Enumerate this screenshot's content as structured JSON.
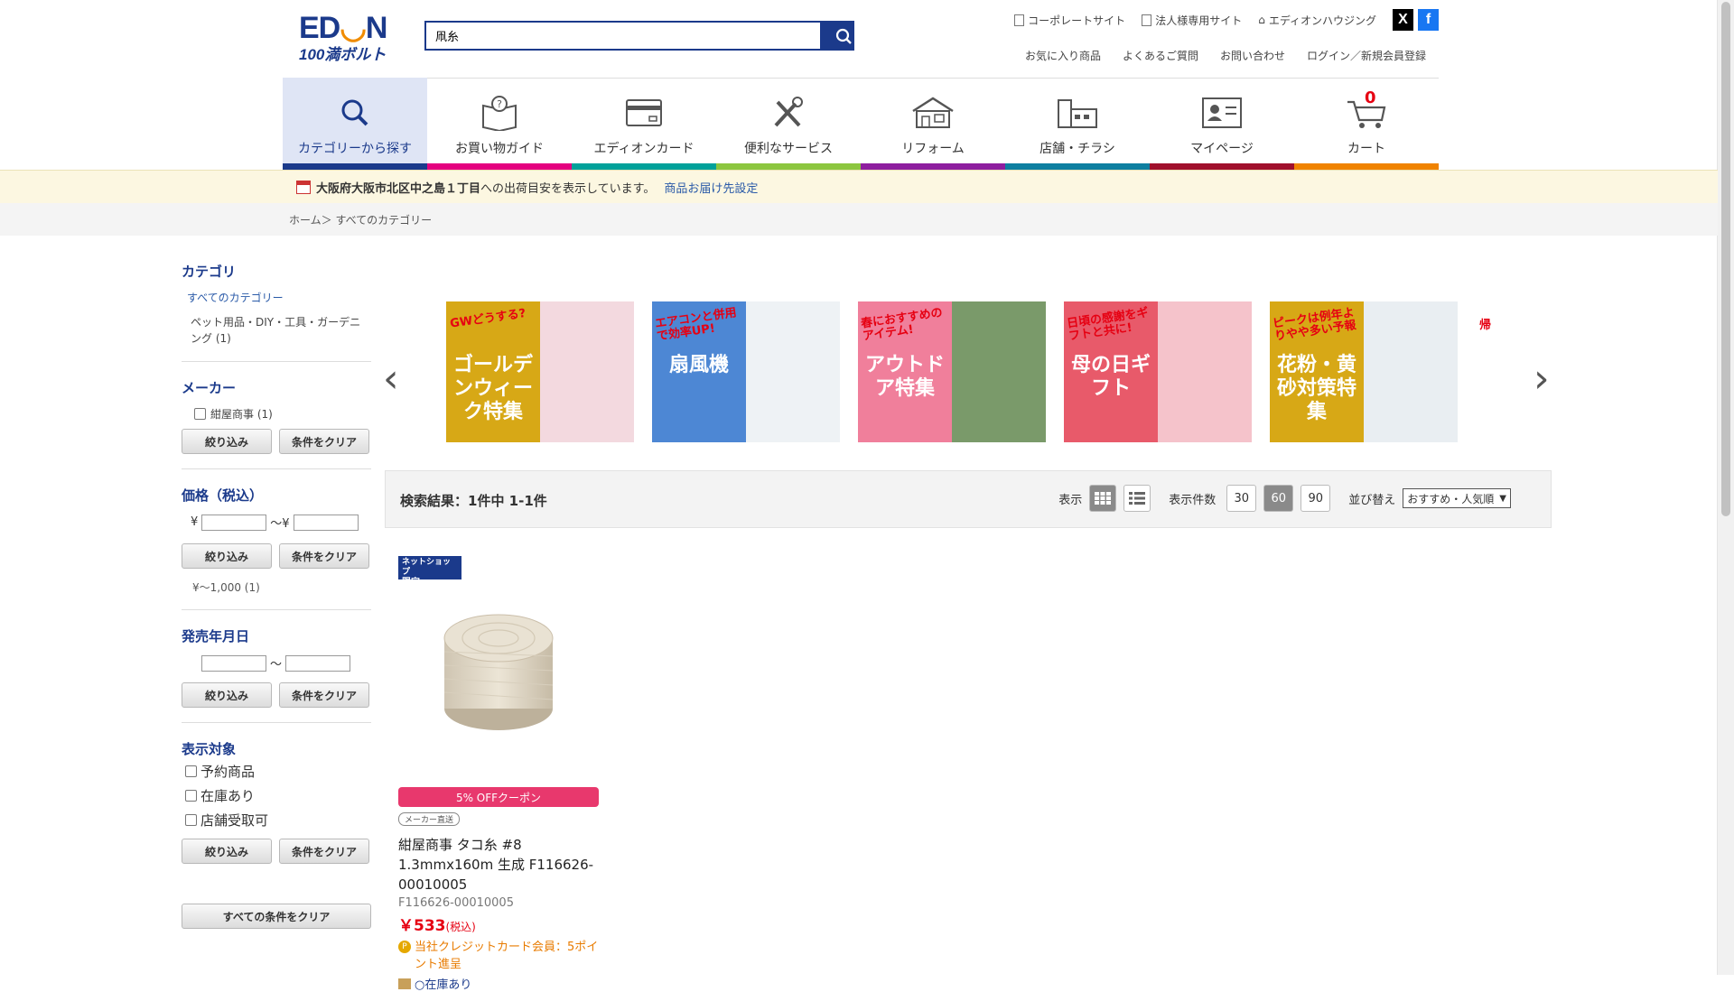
{
  "header": {
    "search_value": "凧糸",
    "top_links": [
      "コーポレートサイト",
      "法人様専用サイト",
      "エディオンハウジング"
    ],
    "sub_links": [
      "お気に入り商品",
      "よくあるご質問",
      "お問い合わせ",
      "ログイン／新規会員登録"
    ]
  },
  "nav": {
    "items": [
      {
        "label": "カテゴリーから探す",
        "color": "#1b3a8b"
      },
      {
        "label": "お買い物ガイド",
        "color": "#e4007f"
      },
      {
        "label": "エディオンカード",
        "color": "#00a19a"
      },
      {
        "label": "便利なサービス",
        "color": "#8cc63f"
      },
      {
        "label": "リフォーム",
        "color": "#8e1e9f"
      },
      {
        "label": "店舗・チラシ",
        "color": "#0e7fa0"
      },
      {
        "label": "マイページ",
        "color": "#a0102c"
      },
      {
        "label": "カート",
        "color": "#f08300"
      }
    ],
    "cart_count": "0"
  },
  "delivery": {
    "address": "大阪府大阪市北区中之島１丁目",
    "message": "への出荷目安を表示しています。",
    "link": "商品お届け先設定"
  },
  "breadcrumb": "ホーム＞ すべてのカテゴリー",
  "sidebar": {
    "category_title": "カテゴリ",
    "category_all": "すべてのカテゴリー",
    "category_sub": "ペット用品・DIY・工具・ガーデニング (1)",
    "maker_title": "メーカー",
    "maker_item": "紺屋商事 (1)",
    "filter_label": "絞り込み",
    "clear_label": "条件をクリア",
    "price_title": "価格（税込）",
    "price_yen1": "¥",
    "price_sep": "〜¥",
    "price_option": "¥〜1,000 (1)",
    "release_title": "発売年月日",
    "release_sep": "〜",
    "display_title": "表示対象",
    "display_items": [
      "予約商品",
      "在庫あり",
      "店舗受取可"
    ],
    "clear_all": "すべての条件をクリア"
  },
  "banners": [
    {
      "tag": "GWどうする?",
      "main": "ゴールデンウィーク特集",
      "bg": "#d7a816",
      "tagcolor": "#e60012",
      "photo": "#f3d9df"
    },
    {
      "tag": "エアコンと併用で効率UP!",
      "main": "扇風機",
      "bg": "#4d87d4",
      "tagcolor": "#e60012",
      "photo": "#eef2f5"
    },
    {
      "tag": "春におすすめのアイテム!",
      "main": "アウトドア特集",
      "bg": "#f07f9b",
      "tagcolor": "#e60012",
      "photo": "#7a9a6a"
    },
    {
      "tag": "日頃の感謝をギフトと共に!",
      "main": "母の日ギフト",
      "bg": "#e85a6a",
      "tagcolor": "#e60012",
      "photo": "#f5c3cb"
    },
    {
      "tag": "ピークは例年よりやや多い予報",
      "main": "花粉・黄砂対策特集",
      "bg": "#d7a816",
      "tagcolor": "#e60012",
      "photo": "#e9eef2"
    },
    {
      "tag": "帰",
      "main": "",
      "bg": "#ffffff",
      "tagcolor": "#e60012",
      "photo": "#4a4a4a"
    }
  ],
  "results": {
    "text": "検索結果：1件中 1-1件",
    "view_label": "表示",
    "count_label": "表示件数",
    "counts": [
      "30",
      "60",
      "90"
    ],
    "sort_label": "並び替え",
    "sort_value": "おすすめ・人気順"
  },
  "product": {
    "badge_line1": "ネットショップ",
    "badge_line2": "限定",
    "coupon": "5% OFFクーポン",
    "maker_tag": "メーカー直送",
    "name": "紺屋商事 タコ糸 #8 1.3mmx160m 生成 F116626-00010005",
    "code": "F116626-00010005",
    "price": "￥533",
    "tax": "(税込)",
    "point_icon": "P",
    "point_text": "当社クレジットカード会員：5ポイント進呈",
    "stock": "○在庫あり"
  }
}
